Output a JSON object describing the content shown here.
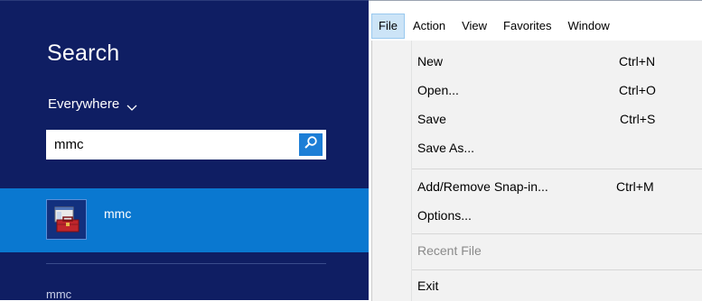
{
  "search": {
    "title": "Search",
    "scope": "Everywhere",
    "query": "mmc",
    "results": [
      {
        "label": "mmc"
      },
      {
        "label": "mmc"
      }
    ]
  },
  "mmc_window": {
    "menus": [
      {
        "label": "File"
      },
      {
        "label": "Action"
      },
      {
        "label": "View"
      },
      {
        "label": "Favorites"
      },
      {
        "label": "Window"
      }
    ],
    "file_menu": {
      "items": [
        {
          "label": "New",
          "shortcut": "Ctrl+N"
        },
        {
          "label": "Open...",
          "shortcut": "Ctrl+O"
        },
        {
          "label": "Save",
          "shortcut": "Ctrl+S"
        },
        {
          "label": "Save As...",
          "shortcut": ""
        },
        {
          "label": "Add/Remove Snap-in...",
          "shortcut": "Ctrl+M"
        },
        {
          "label": "Options...",
          "shortcut": ""
        },
        {
          "label": "Recent File",
          "shortcut": ""
        },
        {
          "label": "Exit",
          "shortcut": ""
        }
      ]
    }
  },
  "colors": {
    "search_bg": "#0f1e63",
    "selected_result": "#0a78d0",
    "search_button": "#1c7ed6",
    "menu_active": "#cce4f7"
  }
}
